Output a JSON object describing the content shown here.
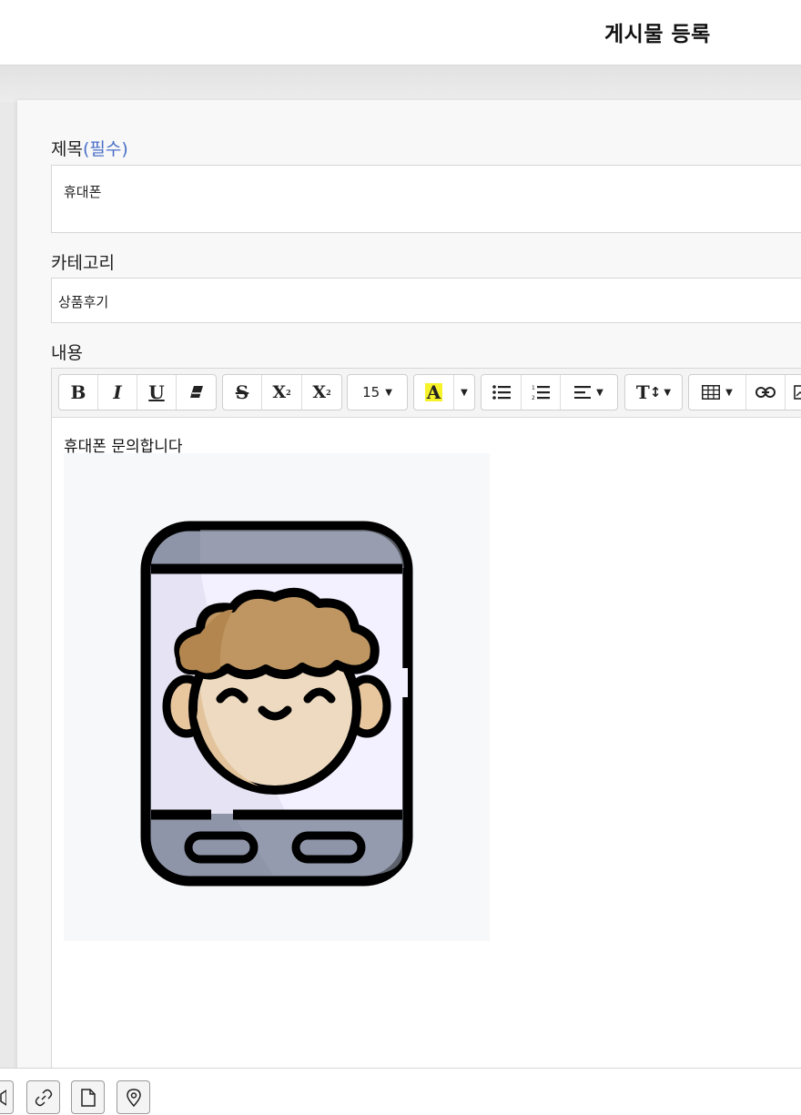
{
  "header": {
    "title": "게시물 등록"
  },
  "form": {
    "title_label": "제목",
    "title_required": "(필수)",
    "title_value": "휴대폰",
    "category_label": "카테고리",
    "category_value": "상품후기",
    "content_label": "내용"
  },
  "toolbar": {
    "bold": "B",
    "italic": "I",
    "underline": "U",
    "strike": "S",
    "superscript": "X",
    "subscript": "X",
    "font_size": "15",
    "font_color": "A",
    "font_color_highlight": "#f7f32b",
    "text_size_label": "T",
    "icons": [
      "eraser-icon",
      "bullet-list-icon",
      "numbered-list-icon",
      "align-icon",
      "table-icon",
      "link-icon"
    ]
  },
  "editor": {
    "content_text": "휴대폰 문의합니다",
    "image_alt": "phone-character-image"
  },
  "bottom_bar": {
    "icons": [
      "audio-icon",
      "link-icon",
      "file-icon",
      "location-pin-icon"
    ]
  }
}
